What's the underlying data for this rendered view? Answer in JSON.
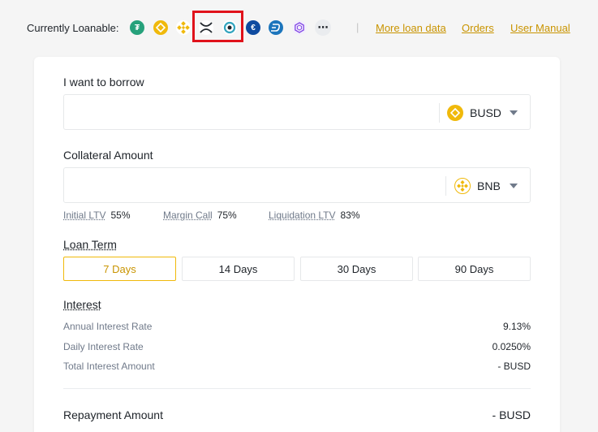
{
  "topbar": {
    "loanable_label": "Currently Loanable:",
    "coins": [
      "tether-icon",
      "busd-icon",
      "bnb-icon",
      "xrp-icon",
      "ont-icon",
      "eur-icon",
      "dash-icon",
      "polygon-icon"
    ],
    "more_label": "⋯",
    "separator": "|",
    "links": {
      "more_loan_data": "More loan data",
      "orders": "Orders",
      "user_manual": "User Manual"
    }
  },
  "borrow": {
    "label": "I want to borrow",
    "input_value": "",
    "coin": "BUSD"
  },
  "collateral": {
    "label": "Collateral Amount",
    "input_value": "",
    "coin": "BNB"
  },
  "ltv": {
    "initial_label": "Initial LTV",
    "initial_value": "55%",
    "margin_label": "Margin Call",
    "margin_value": "75%",
    "liq_label": "Liquidation LTV",
    "liq_value": "83%"
  },
  "loan_term": {
    "title": "Loan Term",
    "options": [
      "7 Days",
      "14 Days",
      "30 Days",
      "90 Days"
    ],
    "selected": "7 Days"
  },
  "interest": {
    "title": "Interest",
    "annual_label": "Annual Interest Rate",
    "annual_value": "9.13%",
    "daily_label": "Daily Interest Rate",
    "daily_value": "0.0250%",
    "total_label": "Total Interest Amount",
    "total_value": "- BUSD"
  },
  "repayment": {
    "label": "Repayment Amount",
    "value": "- BUSD"
  },
  "colors": {
    "accent": "#f0b90b",
    "link": "#c99400",
    "highlight": "#e0121b",
    "tether": "#26a17b",
    "eur": "#0f4ba0",
    "dash": "#1c75bc"
  }
}
